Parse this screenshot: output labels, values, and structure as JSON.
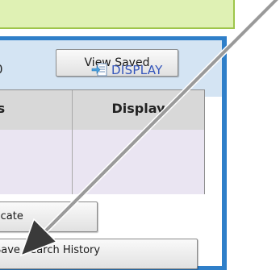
{
  "toolbar": {
    "view_saved_label": "View Saved"
  },
  "table": {
    "headers": {
      "results": "ts",
      "display": "Display"
    },
    "row": {
      "results": "0",
      "display_link": "DISPLAY"
    }
  },
  "actions": {
    "duplicates_label": "icate",
    "save_history_label": "Save Search History"
  },
  "colors": {
    "notice_bg": "#dff1b4",
    "panel_border": "#2f7fc9",
    "link": "#3355bb",
    "row_bg": "#eae5f2"
  }
}
